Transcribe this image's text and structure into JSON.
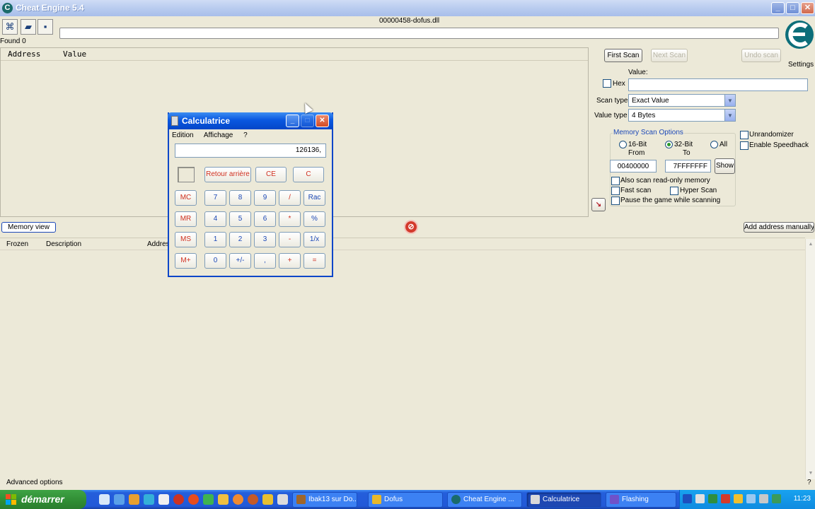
{
  "window": {
    "title": "Cheat Engine 5.4",
    "process": "00000458-dofus.dll",
    "found": "Found 0",
    "settings": "Settings"
  },
  "results": {
    "headers": [
      "Address",
      "Value"
    ]
  },
  "scan": {
    "first_scan": "First Scan",
    "next_scan": "Next Scan",
    "undo_scan": "Undo scan",
    "value_label": "Value:",
    "hex_label": "Hex",
    "value_input": "",
    "scan_type_label": "Scan type",
    "scan_type": "Exact Value",
    "value_type_label": "Value type",
    "value_type": "4 Bytes",
    "memory_scan_options": "Memory Scan Options",
    "bit16": "16-Bit",
    "bit32": "32-Bit",
    "all": "All",
    "from_label": "From",
    "to_label": "To",
    "from_value": "00400000",
    "to_value": "7FFFFFFF",
    "show": "Show",
    "also_readonly": "Also scan read-only memory",
    "fast_scan": "Fast scan",
    "hyper_scan": "Hyper Scan",
    "pause_game": "Pause the game while scanning",
    "unrandomizer": "Unrandomizer",
    "enable_speedhack": "Enable Speedhack"
  },
  "bottom": {
    "memory_view": "Memory view",
    "add_address": "Add address manually",
    "headers": [
      "Frozen",
      "Description",
      "Address"
    ],
    "advanced_options": "Advanced options",
    "help": "?"
  },
  "calculator": {
    "title": "Calculatrice",
    "menu": [
      "Edition",
      "Affichage",
      "?"
    ],
    "display": "126136,",
    "keys": {
      "backspace": "Retour arrière",
      "ce": "CE",
      "c": "C",
      "mc": "MC",
      "mr": "MR",
      "ms": "MS",
      "mplus": "M+",
      "k7": "7",
      "k8": "8",
      "k9": "9",
      "div": "/",
      "sqrt": "Rac",
      "k4": "4",
      "k5": "5",
      "k6": "6",
      "mul": "*",
      "pct": "%",
      "k1": "1",
      "k2": "2",
      "k3": "3",
      "sub": "-",
      "inv": "1/x",
      "k0": "0",
      "sign": "+/-",
      "dot": ",",
      "add": "+",
      "eq": "="
    }
  },
  "taskbar": {
    "start": "démarrer",
    "tasks": [
      {
        "label": "Ibak13 sur Do...",
        "color": "#a0662a"
      },
      {
        "label": "Dofus",
        "color": "#e8b82a"
      },
      {
        "label": "Cheat Engine ...",
        "color": "#1a6b6b"
      },
      {
        "label": "Calculatrice",
        "color": "#d9d9d9"
      },
      {
        "label": "Flashing",
        "color": "#6f52c9"
      }
    ],
    "clock": "11:23"
  }
}
